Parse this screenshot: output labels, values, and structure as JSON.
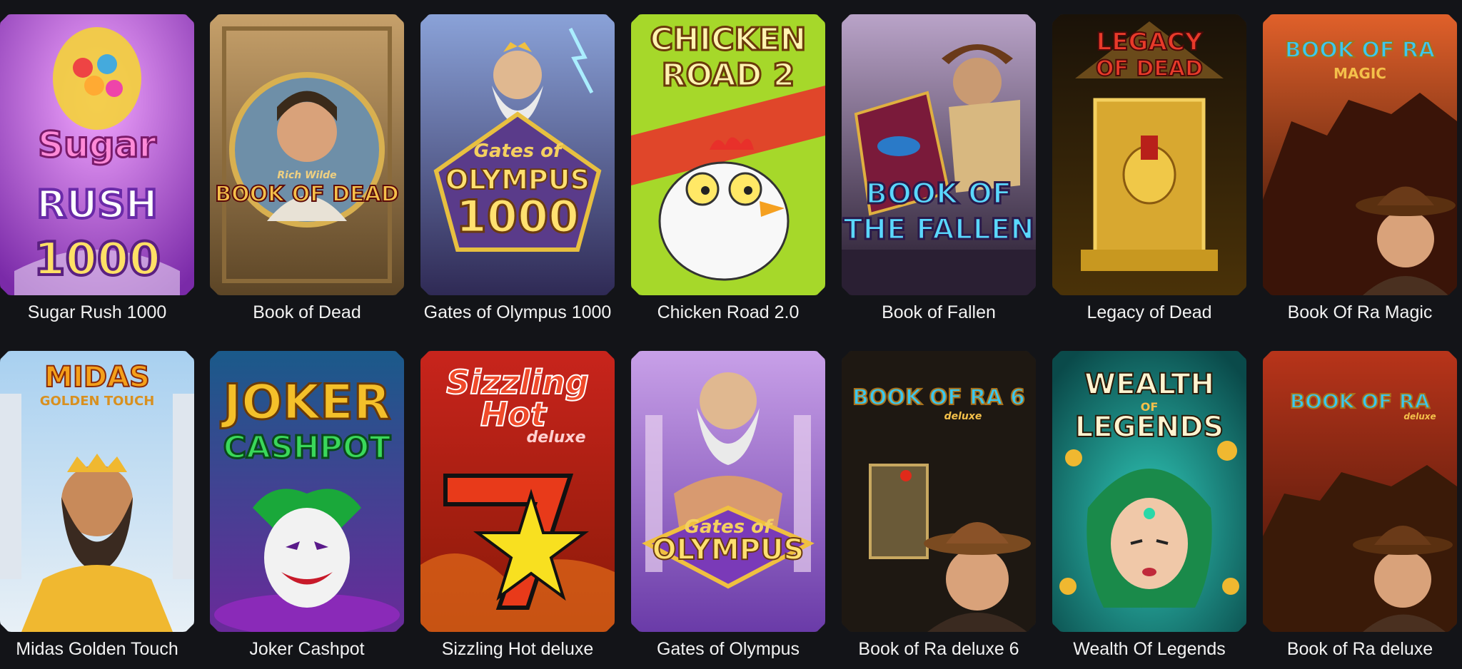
{
  "games": [
    {
      "title": "Sugar Rush 1000",
      "logo": [
        "Sugar",
        "RUSH",
        "1000"
      ],
      "icon": "gumball-machine-icon",
      "colors": [
        "#d65fe6",
        "#8a2db8"
      ]
    },
    {
      "title": "Book of Dead",
      "logo": [
        "Rich Wilde",
        "BOOK OF DEAD"
      ],
      "icon": "explorer-portrait-icon",
      "colors": [
        "#a8865a",
        "#5c4526"
      ]
    },
    {
      "title": "Gates of Olympus 1000",
      "logo": [
        "Gates of",
        "OLYMPUS",
        "1000"
      ],
      "icon": "zeus-icon",
      "colors": [
        "#6a7fb8",
        "#2f2a55"
      ]
    },
    {
      "title": "Chicken Road 2.0",
      "logo": [
        "CHICKEN",
        "ROAD 2"
      ],
      "icon": "chicken-icon",
      "colors": [
        "#a6d82a",
        "#e0462a"
      ]
    },
    {
      "title": "Book of Fallen",
      "logo": [
        "BOOK OF",
        "THE FALLEN"
      ],
      "icon": "book-icon",
      "colors": [
        "#6d5a8a",
        "#2a1f33"
      ]
    },
    {
      "title": "Legacy of Dead",
      "logo": [
        "LEGACY",
        "OF DEAD"
      ],
      "icon": "golden-tomb-icon",
      "colors": [
        "#3a2a10",
        "#c9a02a"
      ]
    },
    {
      "title": "Book Of Ra Magic",
      "logo": [
        "BOOK OF RA",
        "MAGIC"
      ],
      "icon": "explorer-portrait-icon",
      "colors": [
        "#b8431c",
        "#3a1408"
      ]
    },
    {
      "title": "Midas Golden Touch",
      "logo": [
        "MIDAS",
        "GOLDEN TOUCH"
      ],
      "icon": "king-midas-icon",
      "colors": [
        "#9fc8e8",
        "#d8e8f2"
      ]
    },
    {
      "title": "Joker Cashpot",
      "logo": [
        "JOKER",
        "CASHPOT"
      ],
      "icon": "joker-icon",
      "colors": [
        "#1a6a9a",
        "#5a2a8a"
      ]
    },
    {
      "title": "Sizzling Hot deluxe",
      "logo": [
        "Sizzling",
        "Hot",
        "deluxe"
      ],
      "icon": "seven-star-icon",
      "colors": [
        "#c8241c",
        "#6a0e08"
      ]
    },
    {
      "title": "Gates of Olympus",
      "logo": [
        "Gates of",
        "OLYMPUS"
      ],
      "icon": "zeus-icon",
      "colors": [
        "#b87fd8",
        "#6a3ba8"
      ]
    },
    {
      "title": "Book of Ra deluxe 6",
      "logo": [
        "BOOK OF RA 6",
        "deluxe"
      ],
      "icon": "explorer-portrait-icon",
      "colors": [
        "#2a2218",
        "#0e0b08"
      ]
    },
    {
      "title": "Wealth Of Legends",
      "logo": [
        "WEALTH",
        "OF",
        "LEGENDS"
      ],
      "icon": "medusa-icon",
      "colors": [
        "#18a89a",
        "#0a4a4a"
      ]
    },
    {
      "title": "Book of Ra deluxe",
      "logo": [
        "BOOK OF RA",
        "deluxe"
      ],
      "icon": "explorer-portrait-icon",
      "colors": [
        "#c8431c",
        "#3a1408"
      ]
    }
  ]
}
